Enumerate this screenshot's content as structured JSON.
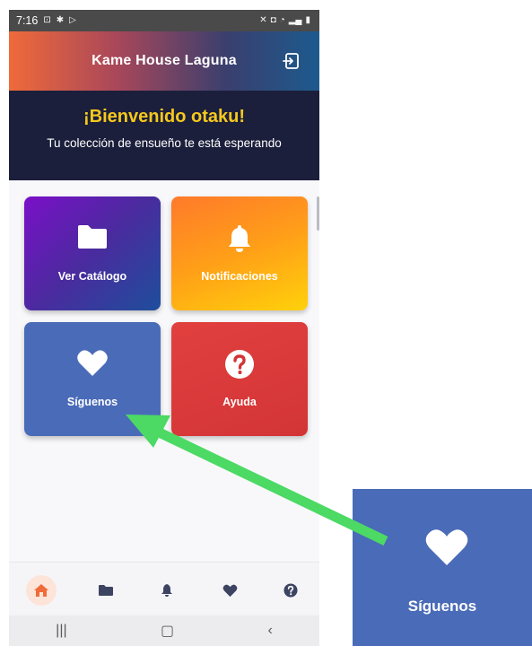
{
  "status_bar": {
    "time": "7:16"
  },
  "app_bar": {
    "title": "Kame House Laguna"
  },
  "welcome": {
    "title": "¡Bienvenido otaku!",
    "subtitle": "Tu colección de ensueño te está esperando"
  },
  "tiles": [
    {
      "label": "Ver Catálogo",
      "icon": "folder-icon"
    },
    {
      "label": "Notificaciones",
      "icon": "bell-icon"
    },
    {
      "label": "Síguenos",
      "icon": "heart-icon"
    },
    {
      "label": "Ayuda",
      "icon": "question-icon"
    }
  ],
  "bottom_nav": {
    "active": "home",
    "items": [
      "home-icon",
      "folder-icon",
      "bell-icon",
      "heart-icon",
      "help-icon"
    ]
  },
  "zoom_callout": {
    "label": "Síguenos",
    "icon": "heart-icon"
  },
  "colors": {
    "accent_orange": "#f06a3a",
    "welcome_bg": "#1b1f3b",
    "welcome_title": "#f6c81d",
    "follow_tile": "#4a6bb8",
    "help_tile": "#d33436",
    "arrow": "#4cd964"
  }
}
